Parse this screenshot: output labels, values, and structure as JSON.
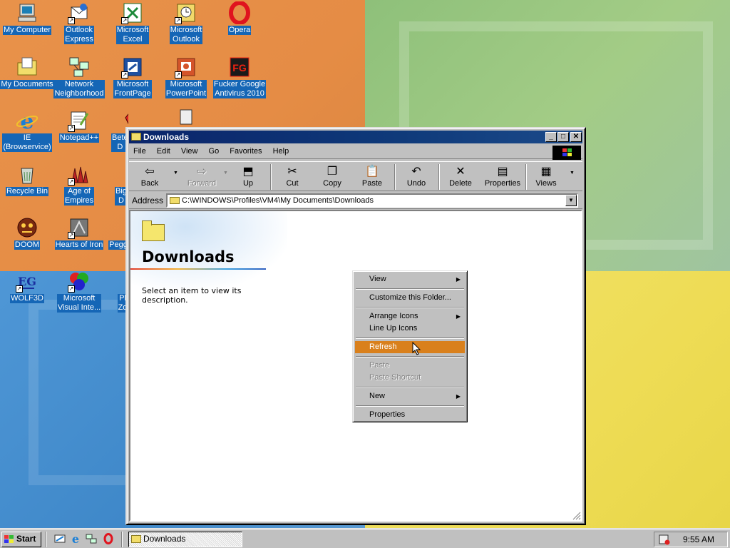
{
  "desktop": {
    "icons": [
      {
        "label": "My Computer",
        "icon": "computer-icon"
      },
      {
        "label": "Outlook\nExpress",
        "icon": "outlook-express-icon"
      },
      {
        "label": "Microsoft\nExcel",
        "icon": "excel-icon"
      },
      {
        "label": "Microsoft\nOutlook",
        "icon": "outlook-icon"
      },
      {
        "label": "Opera",
        "icon": "opera-icon"
      },
      {
        "label": "My Documents",
        "icon": "documents-folder-icon"
      },
      {
        "label": "Network\nNeighborhood",
        "icon": "network-icon"
      },
      {
        "label": "Microsoft\nFrontPage",
        "icon": "frontpage-icon"
      },
      {
        "label": "Microsoft\nPowerPoint",
        "icon": "powerpoint-icon"
      },
      {
        "label": "Fucker Google\nAntivirus 2010",
        "icon": "antivirus-icon"
      },
      {
        "label": "IE\n(Browservice)",
        "icon": "internet-explorer-icon"
      },
      {
        "label": "Notepad++",
        "icon": "notepad-icon"
      },
      {
        "label": "Recycle Bin",
        "icon": "recycle-bin-icon"
      },
      {
        "label": "Age of\nEmpires",
        "icon": "age-of-empires-icon"
      },
      {
        "label": "DOOM",
        "icon": "doom-icon"
      },
      {
        "label": "Hearts of Iron",
        "icon": "hearts-of-iron-icon"
      },
      {
        "label": "WOLF3D",
        "icon": "wolf3d-icon"
      },
      {
        "label": "Microsoft\nVisual Inte...",
        "icon": "visual-interdev-icon"
      }
    ],
    "partial_labels": [
      "Bete\nD",
      "Big\nD",
      "Pegg",
      "Pl\nZo"
    ]
  },
  "window": {
    "title": "Downloads",
    "menus": [
      "File",
      "Edit",
      "View",
      "Go",
      "Favorites",
      "Help"
    ],
    "toolbar": {
      "back": "Back",
      "forward": "Forward",
      "up": "Up",
      "cut": "Cut",
      "copy": "Copy",
      "paste": "Paste",
      "undo": "Undo",
      "delete": "Delete",
      "properties": "Properties",
      "views": "Views"
    },
    "address_label": "Address",
    "address_value": "C:\\WINDOWS\\Profiles\\VM4\\My Documents\\Downloads",
    "folder_title": "Downloads",
    "description": "Select an item to view its\ndescription."
  },
  "context_menu": {
    "items": [
      {
        "label": "View",
        "submenu": true,
        "state": "normal"
      },
      {
        "label": "Customize this Folder...",
        "submenu": false,
        "state": "normal"
      },
      {
        "label": "Arrange Icons",
        "submenu": true,
        "state": "normal"
      },
      {
        "label": "Line Up Icons",
        "submenu": false,
        "state": "normal"
      },
      {
        "label": "Refresh",
        "submenu": false,
        "state": "highlighted"
      },
      {
        "label": "Paste",
        "submenu": false,
        "state": "disabled"
      },
      {
        "label": "Paste Shortcut",
        "submenu": false,
        "state": "disabled"
      },
      {
        "label": "New",
        "submenu": true,
        "state": "normal"
      },
      {
        "label": "Properties",
        "submenu": false,
        "state": "normal"
      }
    ]
  },
  "taskbar": {
    "start_label": "Start",
    "task_label": "Downloads",
    "clock": "9:55 AM"
  },
  "colors": {
    "titlebar": "#0a246a",
    "menu_highlight": "#d9801c",
    "icon_label_bg": "#1566b6"
  }
}
